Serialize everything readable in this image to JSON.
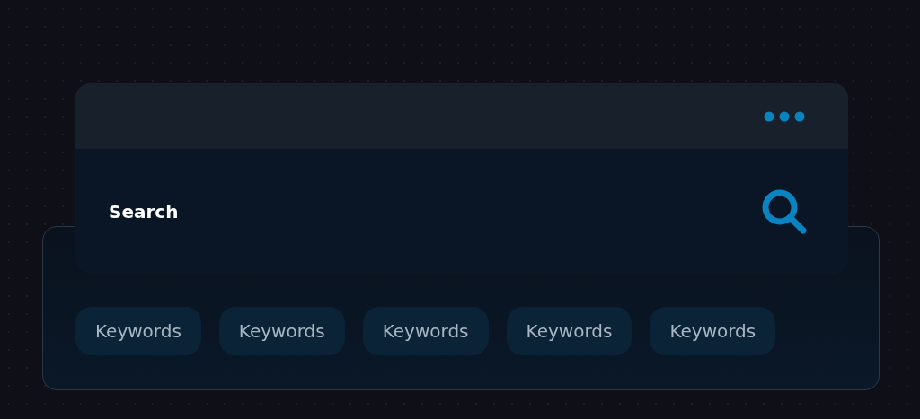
{
  "search": {
    "label": "Search"
  },
  "keywords": [
    {
      "label": "Keywords"
    },
    {
      "label": "Keywords"
    },
    {
      "label": "Keywords"
    },
    {
      "label": "Keywords"
    },
    {
      "label": "Keywords"
    }
  ]
}
